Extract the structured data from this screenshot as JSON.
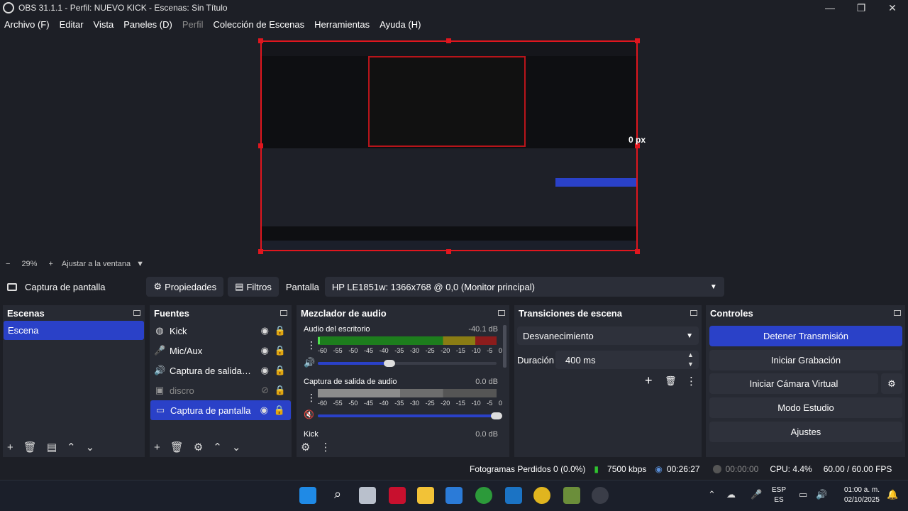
{
  "window": {
    "title": "OBS 31.1.1 - Perfil: NUEVO KICK - Escenas: Sin Título",
    "min_symbol": "—",
    "max_symbol": "❐",
    "close_symbol": "✕"
  },
  "menu": [
    "Archivo (F)",
    "Editar",
    "Vista",
    "Paneles (D)",
    "Perfil",
    "Colección de Escenas",
    "Herramientas",
    "Ayuda (H)"
  ],
  "preview": {
    "size_label": "0 px",
    "zoom": "29%",
    "fit_label": "Ajustar a la ventana",
    "minus": "−",
    "plus": "+"
  },
  "source_toolbar": {
    "source_name": "Captura de pantalla",
    "properties": "Propiedades",
    "filters": "Filtros",
    "display_label": "Pantalla",
    "display_value": "HP LE1851w: 1366x768 @ 0,0 (Monitor principal)"
  },
  "scenes": {
    "title": "Escenas",
    "items": [
      "Escena"
    ]
  },
  "sources": {
    "title": "Fuentes",
    "items": [
      {
        "name": "Kick",
        "icon": "globe-icon"
      },
      {
        "name": "Mic/Aux",
        "icon": "microphone-icon"
      },
      {
        "name": "Captura de salida de audio",
        "icon": "speaker-icon"
      },
      {
        "name": "discro",
        "icon": "window-icon"
      },
      {
        "name": "Captura de pantalla",
        "icon": "monitor-icon"
      }
    ]
  },
  "mixer": {
    "title": "Mezclador de audio",
    "scale": [
      "-60",
      "-55",
      "-50",
      "-45",
      "-40",
      "-35",
      "-30",
      "-25",
      "-20",
      "-15",
      "-10",
      "-5",
      "0"
    ],
    "channels": [
      {
        "name": "Audio del escritorio",
        "db": "-40.1 dB",
        "volume": 0.4
      },
      {
        "name": "Captura de salida de audio",
        "db": "0.0 dB",
        "volume": 1.0
      },
      {
        "name": "Kick",
        "db": "0.0 dB"
      }
    ]
  },
  "transitions": {
    "title": "Transiciones de escena",
    "selected": "Desvanecimiento",
    "duration_label": "Duración",
    "duration_value": "400 ms"
  },
  "controls": {
    "title": "Controles",
    "stop_stream": "Detener Transmisión",
    "start_recording": "Iniciar Grabación",
    "virtual_cam": "Iniciar Cámara Virtual",
    "studio_mode": "Modo Estudio",
    "settings": "Ajustes"
  },
  "status": {
    "dropped": "Fotogramas Perdidos 0 (0.0%)",
    "bitrate": "7500 kbps",
    "stream_time": "00:26:27",
    "rec_time": "00:00:00",
    "cpu": "CPU: 4.4%",
    "fps": "60.00 / 60.00 FPS"
  },
  "taskbar": {
    "lang_top": "ESP",
    "lang_bottom": "ES",
    "time": "01:00 a. m.",
    "date": "02/10/2025"
  },
  "colors": {
    "accent": "#2a41c8",
    "selection_border": "#e0161e"
  }
}
